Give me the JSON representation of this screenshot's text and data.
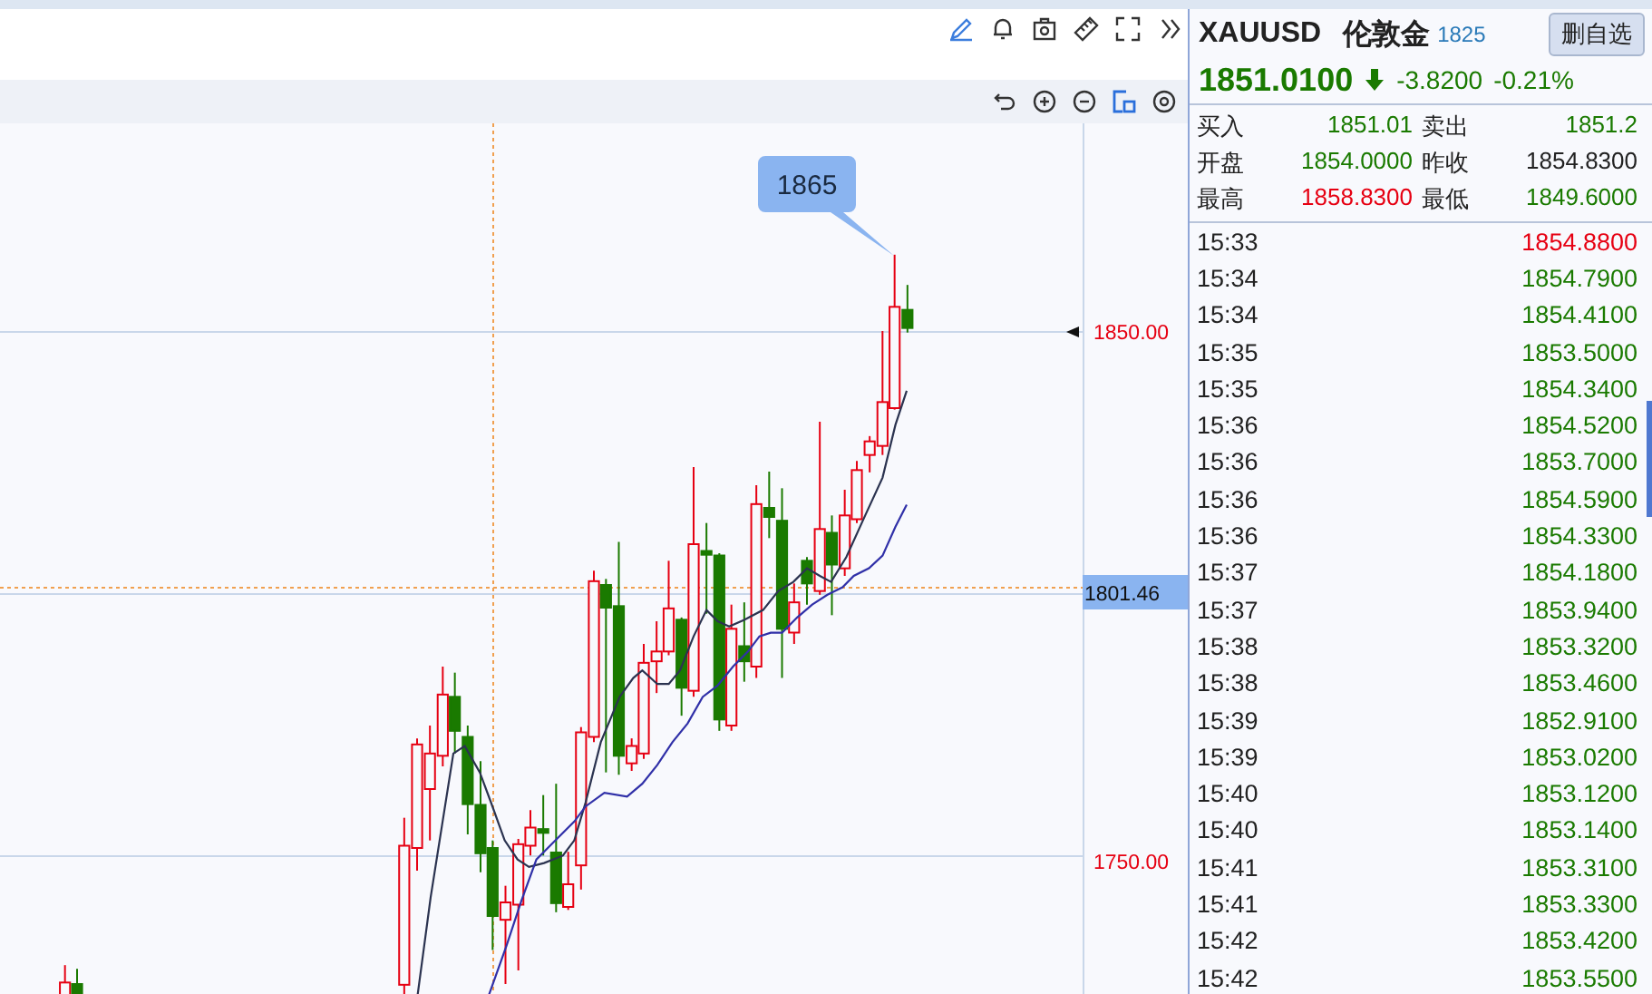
{
  "chart": {
    "callout": "1865",
    "axis_labels": [
      {
        "text": "1850.00",
        "kind": "level"
      },
      {
        "text": "1801.46",
        "kind": "current"
      },
      {
        "text": "1750.00",
        "kind": "level"
      }
    ]
  },
  "quote": {
    "symbol": "XAUUSD",
    "name": "伦敦金",
    "code": "1825",
    "button": "删自选",
    "price": "1851.0100",
    "falling": true,
    "change": "-3.8200",
    "change_pct": "-0.21%",
    "fields": [
      {
        "label": "买入",
        "value": "1851.01",
        "color": "#1a7a00"
      },
      {
        "label": "卖出",
        "value": "1851.2",
        "color": "#1a7a00"
      },
      {
        "label": "开盘",
        "value": "1854.0000",
        "color": "#1a7a00"
      },
      {
        "label": "昨收",
        "value": "1854.8300",
        "color": "#222222"
      },
      {
        "label": "最高",
        "value": "1858.8300",
        "color": "#e60012"
      },
      {
        "label": "最低",
        "value": "1849.6000",
        "color": "#1a7a00"
      }
    ]
  },
  "ticks": [
    {
      "time": "15:33",
      "price": "1854.8800",
      "color": "#e60012"
    },
    {
      "time": "15:34",
      "price": "1854.7900",
      "color": "#1a7a00"
    },
    {
      "time": "15:34",
      "price": "1854.4100",
      "color": "#1a7a00"
    },
    {
      "time": "15:35",
      "price": "1853.5000",
      "color": "#1a7a00"
    },
    {
      "time": "15:35",
      "price": "1854.3400",
      "color": "#1a7a00"
    },
    {
      "time": "15:36",
      "price": "1854.5200",
      "color": "#1a7a00"
    },
    {
      "time": "15:36",
      "price": "1853.7000",
      "color": "#1a7a00"
    },
    {
      "time": "15:36",
      "price": "1854.5900",
      "color": "#1a7a00"
    },
    {
      "time": "15:36",
      "price": "1854.3300",
      "color": "#1a7a00"
    },
    {
      "time": "15:37",
      "price": "1854.1800",
      "color": "#1a7a00"
    },
    {
      "time": "15:37",
      "price": "1853.9400",
      "color": "#1a7a00"
    },
    {
      "time": "15:38",
      "price": "1853.3200",
      "color": "#1a7a00"
    },
    {
      "time": "15:38",
      "price": "1853.4600",
      "color": "#1a7a00"
    },
    {
      "time": "15:39",
      "price": "1852.9100",
      "color": "#1a7a00"
    },
    {
      "time": "15:39",
      "price": "1853.0200",
      "color": "#1a7a00"
    },
    {
      "time": "15:40",
      "price": "1853.1200",
      "color": "#1a7a00"
    },
    {
      "time": "15:40",
      "price": "1853.1400",
      "color": "#1a7a00"
    },
    {
      "time": "15:41",
      "price": "1853.3100",
      "color": "#1a7a00"
    },
    {
      "time": "15:41",
      "price": "1853.3300",
      "color": "#1a7a00"
    },
    {
      "time": "15:42",
      "price": "1853.4200",
      "color": "#1a7a00"
    },
    {
      "time": "15:42",
      "price": "1853.5500",
      "color": "#1a7a00"
    }
  ]
}
